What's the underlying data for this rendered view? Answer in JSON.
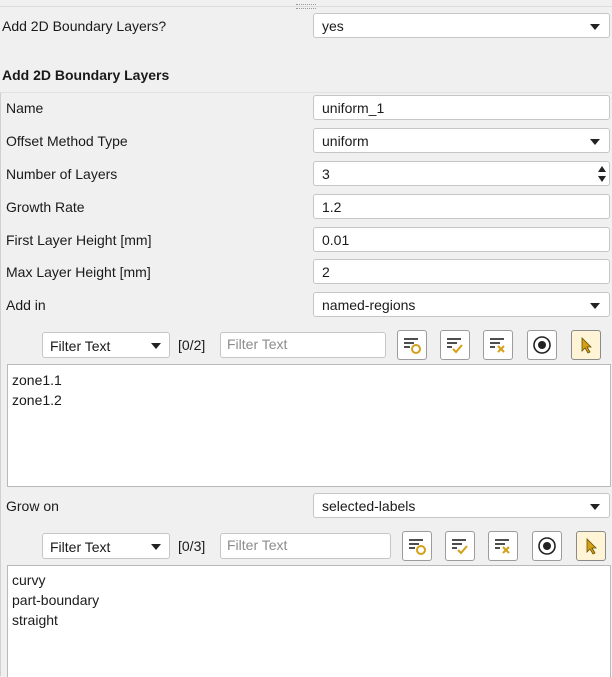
{
  "top": {
    "label": "Add 2D Boundary Layers?",
    "value": "yes"
  },
  "section": {
    "title": "Add 2D Boundary Layers"
  },
  "fields": {
    "name": {
      "label": "Name",
      "value": "uniform_1"
    },
    "offset_method": {
      "label": "Offset Method Type",
      "value": "uniform"
    },
    "num_layers": {
      "label": "Number of Layers",
      "value": "3"
    },
    "growth_rate": {
      "label": "Growth Rate",
      "value": "1.2"
    },
    "first_height": {
      "label": "First Layer Height [mm]",
      "value": "0.01"
    },
    "max_height": {
      "label": "Max Layer Height [mm]",
      "value": "2"
    },
    "add_in": {
      "label": "Add in",
      "value": "named-regions"
    },
    "grow_on": {
      "label": "Grow on",
      "value": "selected-labels"
    }
  },
  "add_in_list": {
    "filter_mode": "Filter Text",
    "count": "[0/2]",
    "filter_placeholder": "Filter Text",
    "items": [
      "zone1.1",
      "zone1.2"
    ]
  },
  "grow_on_list": {
    "filter_mode": "Filter Text",
    "count": "[0/3]",
    "filter_placeholder": "Filter Text",
    "items": [
      "curvy",
      "part-boundary",
      "straight"
    ]
  },
  "toolbar_icons": [
    "filter-options-icon",
    "select-all-icon",
    "deselect-all-icon",
    "radio-toggle-icon",
    "pointer-pick-icon"
  ],
  "colors": {
    "icon_accent": "#d4a017",
    "active_button_bg": "#fff5d6"
  }
}
